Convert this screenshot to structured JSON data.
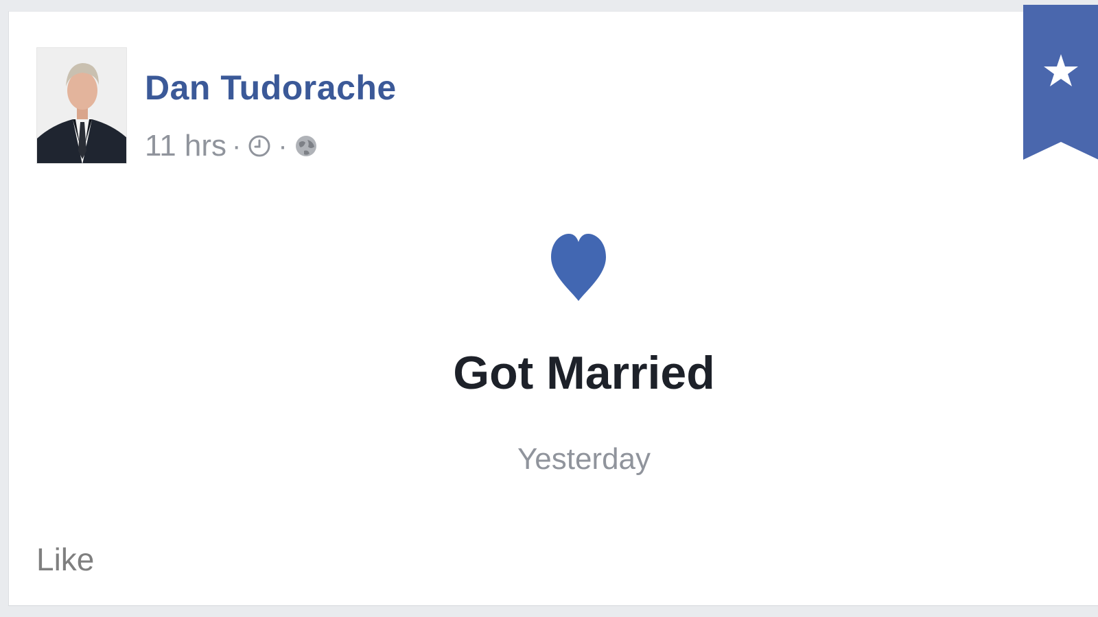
{
  "post": {
    "author": "Dan Tudorache",
    "timestamp": "11 hrs",
    "separator": "·",
    "time_icon": "clock-icon",
    "privacy_icon": "globe-icon",
    "avatar_icon": "profile-photo"
  },
  "life_event": {
    "icon": "heart-icon",
    "title": "Got Married",
    "date": "Yesterday"
  },
  "actions": {
    "like_label": "Like"
  },
  "bookmark": {
    "icon": "star-icon"
  },
  "colors": {
    "brand_blue": "#3b5998",
    "heart_blue": "#4267b2",
    "text_dark": "#1d2129",
    "text_gray": "#90949c"
  }
}
